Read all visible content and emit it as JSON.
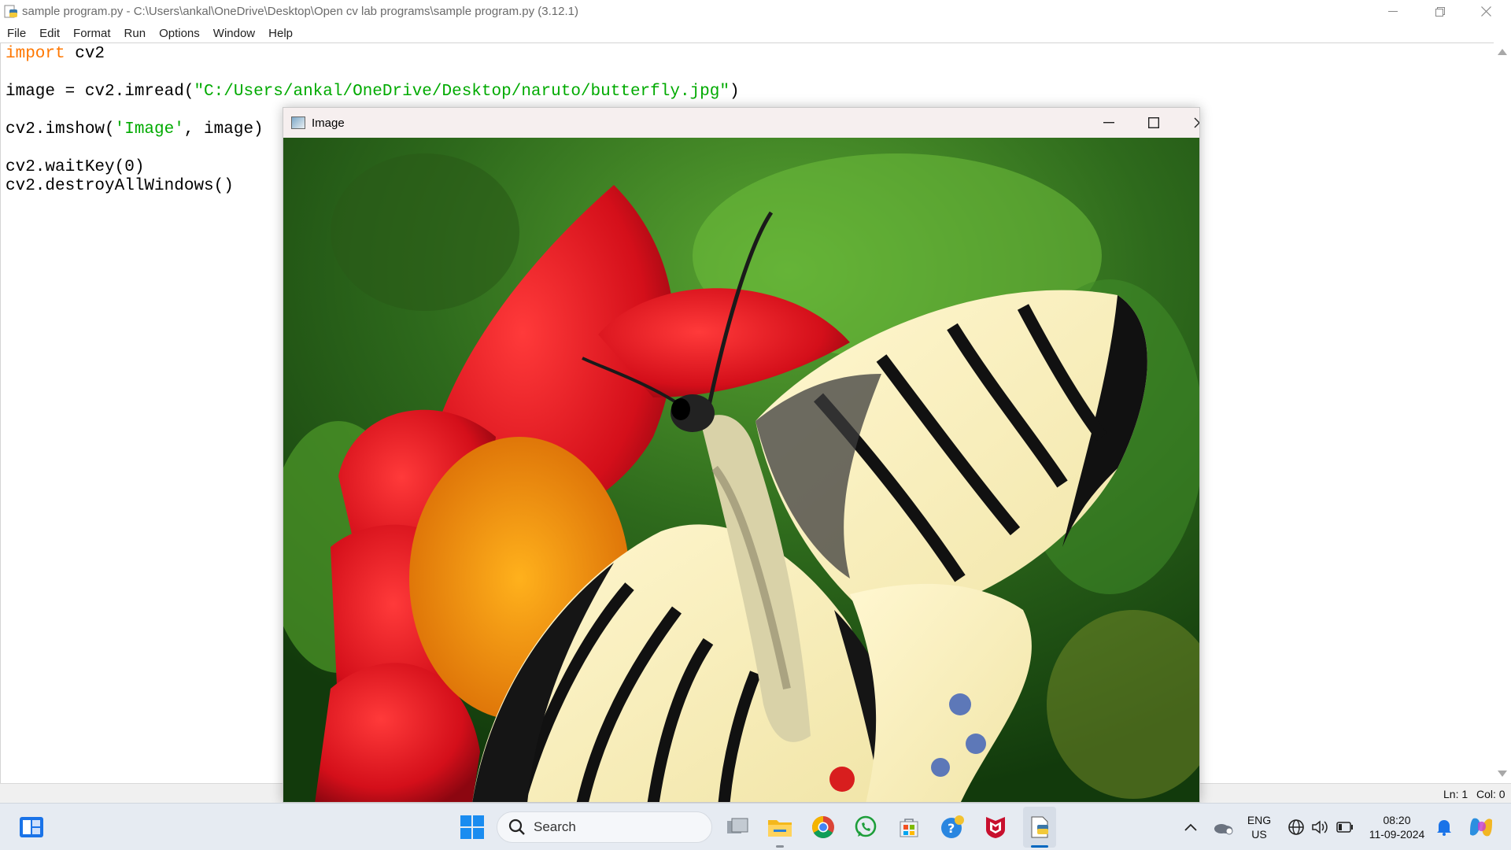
{
  "idle": {
    "title": "sample program.py - C:\\Users\\ankal\\OneDrive\\Desktop\\Open cv lab programs\\sample program.py (3.12.1)",
    "menu": [
      "File",
      "Edit",
      "Format",
      "Run",
      "Options",
      "Window",
      "Help"
    ],
    "code": {
      "l1_kw": "import",
      "l1_rest": " cv2",
      "l3_a": "image = cv2.imread(",
      "l3_str": "\"C:/Users/ankal/OneDrive/Desktop/naruto/butterfly.jpg\"",
      "l3_b": ")",
      "l5_a": "cv2.imshow(",
      "l5_str": "'Image'",
      "l5_b": ", image)",
      "l7": "cv2.waitKey(0)",
      "l8": "cv2.destroyAllWindows()"
    },
    "status": {
      "line": "Ln: 1",
      "col": "Col: 0"
    }
  },
  "image_window": {
    "title": "Image",
    "minimize_glyph": "—",
    "maximize_glyph": "☐",
    "close_glyph": "✕"
  },
  "taskbar": {
    "search_placeholder": "Search",
    "lang_line1": "ENG",
    "lang_line2": "US",
    "time": "08:20",
    "date": "11-09-2024",
    "icons": [
      "windows-start-icon",
      "search-icon",
      "task-view-icon",
      "file-explorer-icon",
      "chrome-icon",
      "whatsapp-icon",
      "microsoft-store-icon",
      "help-icon",
      "mcafee-icon",
      "idle-python-icon",
      "chevron-up-icon",
      "onedrive-icon",
      "network-icon",
      "volume-icon",
      "battery-icon",
      "bell-icon",
      "copilot-icon"
    ],
    "accent": "#0067c0"
  },
  "colors": {
    "keyword": "#ff7700",
    "string": "#00aa00",
    "image_titlebar": "#f6efef"
  }
}
